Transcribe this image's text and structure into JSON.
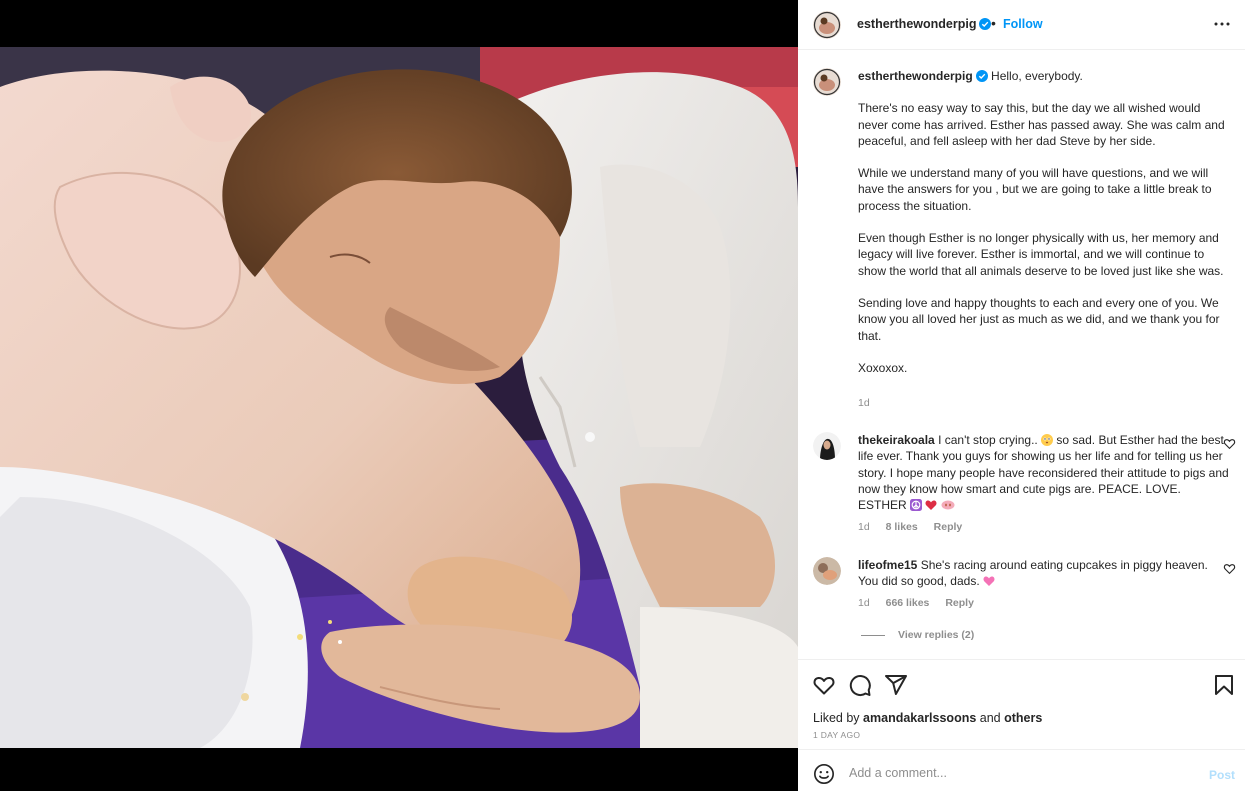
{
  "post": {
    "username": "estherthewonderpig",
    "follow_label": "Follow",
    "separator": "•",
    "icons": {
      "verified": "verified-badge-icon",
      "more": "more-options-icon"
    }
  },
  "caption": {
    "username": "estherthewonderpig",
    "greeting": "Hello, everybody.",
    "paragraphs": [
      "There's no easy way to say this, but the day we all wished would never come has arrived. Esther has passed away. She was calm and peaceful, and fell asleep with her dad Steve by her side.",
      "While we understand many of you will have questions, and we will have the answers for you , but we are going to take a little break to process the situation.",
      "Even though Esther is no longer physically with us, her memory and legacy will live forever. Esther is immortal, and we will continue to show the world that all animals deserve to be loved just like she was.",
      "Sending love and happy thoughts to each and every one of you. We know you all loved her just as much as we did, and we thank you for that.",
      "Xoxoxox."
    ],
    "time": "1d"
  },
  "comments": [
    {
      "username": "thekeirakoala",
      "text_a": "I can't stop crying..",
      "text_b": "so sad. But Esther had the best life ever. Thank you guys for showing us her life and for telling us her story. I hope many people have reconsidered their attitude to pigs and now they know how smart and cute pigs are. PEACE. LOVE. ESTHER",
      "time": "1d",
      "likes": "8 likes",
      "reply": "Reply"
    },
    {
      "username": "lifeofme15",
      "text": "She's racing around eating cupcakes in piggy heaven. You did so good, dads.",
      "time": "1d",
      "likes": "666 likes",
      "reply": "Reply"
    }
  ],
  "view_replies": "View replies (2)",
  "actions": {
    "liked_prefix": "Liked by",
    "liked_user": "amandakarlssoons",
    "liked_and": "and",
    "liked_others": "others",
    "time_ago": "1 DAY AGO"
  },
  "add_comment": {
    "placeholder": "Add a comment...",
    "post_label": "Post"
  },
  "colors": {
    "link_blue": "#0095f6",
    "post_disabled": "#b2dffc",
    "muted": "#8e8e8e",
    "text": "#262626",
    "heart_red": "#ed4956"
  }
}
